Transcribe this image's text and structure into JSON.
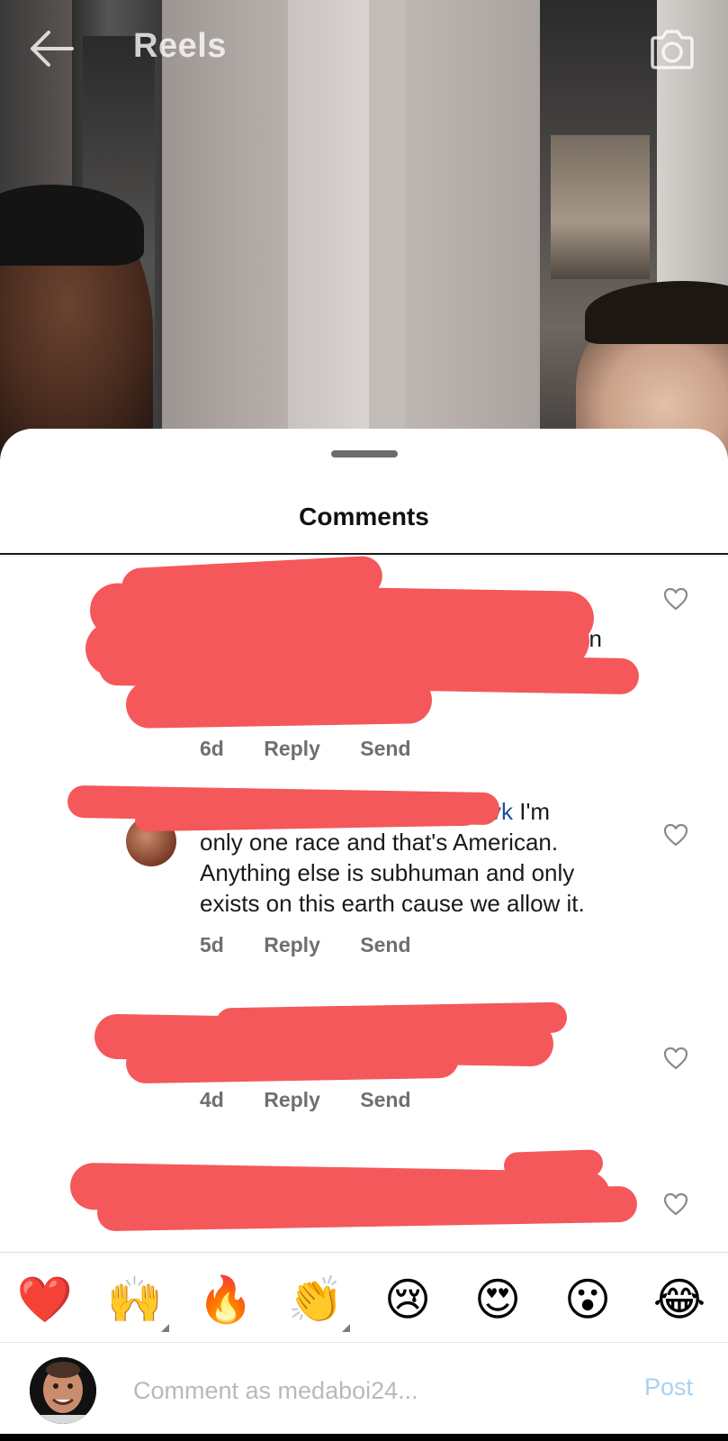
{
  "header": {
    "title": "Reels",
    "back_icon": "arrow-left-icon",
    "camera_icon": "camera-icon"
  },
  "sheet": {
    "title": "Comments"
  },
  "comments": [
    {
      "visible_text_fragments": [
        "en",
        "?"
      ],
      "age": "6d",
      "reply_label": "Reply",
      "send_label": "Send",
      "redacted": true
    },
    {
      "mention_fragment": "vk",
      "text_line1": " I'm",
      "text_line2": "only one race and that's American.",
      "text_line3": "Anything else is subhuman and only",
      "text_line4": "exists on this earth cause we allow it.",
      "age": "5d",
      "reply_label": "Reply",
      "send_label": "Send",
      "redacted_partial": true
    },
    {
      "age": "4d",
      "reply_label": "Reply",
      "send_label": "Send",
      "redacted": true
    },
    {
      "redacted": true
    }
  ],
  "emoji_bar": {
    "items": [
      "❤️",
      "🙌",
      "🔥",
      "👏",
      "😢",
      "😍",
      "😮",
      "😂"
    ]
  },
  "input": {
    "placeholder": "Comment as medaboi24...",
    "post_label": "Post"
  },
  "colors": {
    "redaction": "#f4585a",
    "post_button_disabled": "#a7d3f2",
    "meta_text": "#6f6f6f"
  }
}
